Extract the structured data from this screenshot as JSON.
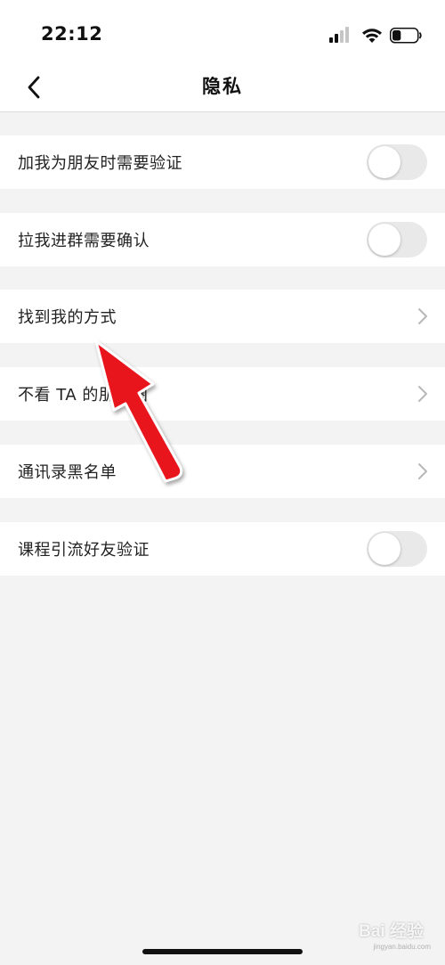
{
  "status_bar": {
    "time": "22:12",
    "icons": [
      "cellular-signal-icon",
      "wifi-icon",
      "battery-icon"
    ],
    "battery_level": 0.35
  },
  "nav": {
    "back_icon": "chevron-left-icon",
    "title": "隐私"
  },
  "settings": [
    {
      "label": "加我为朋友时需要验证",
      "control": "toggle",
      "on": false
    },
    {
      "label": "拉我进群需要确认",
      "control": "toggle",
      "on": false
    },
    {
      "label": "找到我的方式",
      "control": "chevron"
    },
    {
      "label": "不看 TA 的朋友圈",
      "control": "chevron"
    },
    {
      "label": "通讯录黑名单",
      "control": "chevron"
    },
    {
      "label": "课程引流好友验证",
      "control": "toggle",
      "on": false
    }
  ],
  "annotation": {
    "type": "red-arrow",
    "points_to": "找到我的方式",
    "color": "#e8121e"
  },
  "watermark": {
    "text": "Bai 经验",
    "sub": "jingyan.baidu.com"
  },
  "colors": {
    "background": "#f3f3f3",
    "row_background": "#ffffff",
    "toggle_off": "#e9e9e9",
    "chevron": "#b8b8b8"
  }
}
